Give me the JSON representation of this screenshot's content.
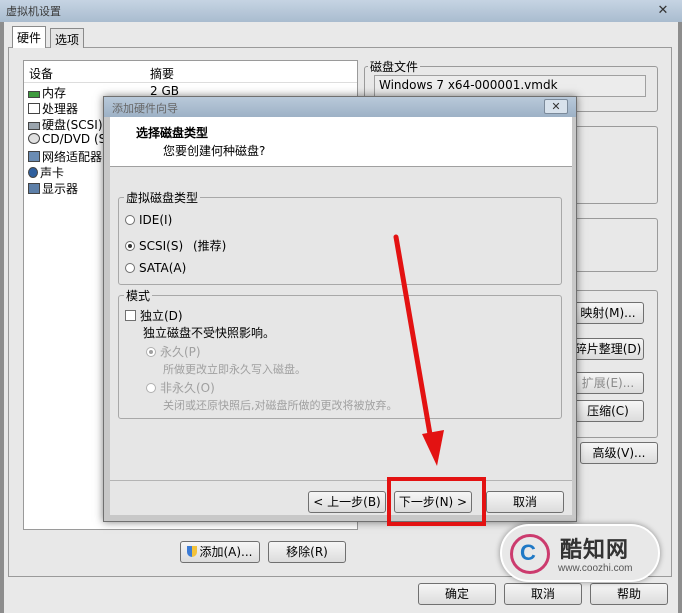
{
  "window": {
    "title": "虚拟机设置",
    "close_glyph": "✕"
  },
  "tabs": [
    {
      "label": "硬件"
    },
    {
      "label": "选项"
    }
  ],
  "device_list": {
    "columns": {
      "device": "设备",
      "summary": "摘要"
    },
    "items": [
      {
        "label": "内存",
        "summary": "2 GB",
        "icon": "memory-icon"
      },
      {
        "label": "处理器",
        "summary": "",
        "icon": "cpu-icon"
      },
      {
        "label": "硬盘(SCSI)",
        "summary": "",
        "icon": "hard-disk-icon"
      },
      {
        "label": "CD/DVD (SA",
        "summary": "",
        "icon": "cd-dvd-icon"
      },
      {
        "label": "网络适配器",
        "summary": "",
        "icon": "network-adapter-icon"
      },
      {
        "label": "声卡",
        "summary": "",
        "icon": "sound-card-icon"
      },
      {
        "label": "显示器",
        "summary": "",
        "icon": "display-icon"
      }
    ]
  },
  "disk_file": {
    "group_title": "磁盘文件",
    "value": "Windows 7 x64-000001.vmdk"
  },
  "right_buttons": {
    "map": "映射(M)...",
    "defrag": "碎片整理(D)",
    "expand": "扩展(E)...",
    "compact": "压缩(C)",
    "advanced": "高级(V)..."
  },
  "list_buttons": {
    "add": "添加(A)...",
    "remove": "移除(R)"
  },
  "bottom_buttons": {
    "ok": "确定",
    "cancel": "取消",
    "help": "帮助"
  },
  "dialog": {
    "title": "添加硬件向导",
    "close_glyph": "✕",
    "heading": "选择磁盘类型",
    "subheading": "您要创建何种磁盘?",
    "disk_type": {
      "group_title": "虚拟磁盘类型",
      "options": [
        {
          "label": "IDE(I)",
          "checked": false
        },
        {
          "label": "SCSI(S)",
          "note": "(推荐)",
          "checked": true
        },
        {
          "label": "SATA(A)",
          "checked": false
        }
      ]
    },
    "mode": {
      "group_title": "模式",
      "independent_label": "独立(D)",
      "independent_checked": false,
      "independent_desc": "独立磁盘不受快照影响。",
      "persistent_label": "永久(P)",
      "persistent_desc": "所做更改立即永久写入磁盘。",
      "nonpersistent_label": "非永久(O)",
      "nonpersistent_desc": "关闭或还原快照后,对磁盘所做的更改将被放弃。"
    },
    "buttons": {
      "back": "< 上一步(B)",
      "next": "下一步(N) >",
      "cancel": "取消"
    }
  },
  "annotation": {
    "color": "#e31212"
  },
  "watermark": {
    "logo_letter": "C",
    "name": "酷知网",
    "url": "www.coozhi.com"
  }
}
